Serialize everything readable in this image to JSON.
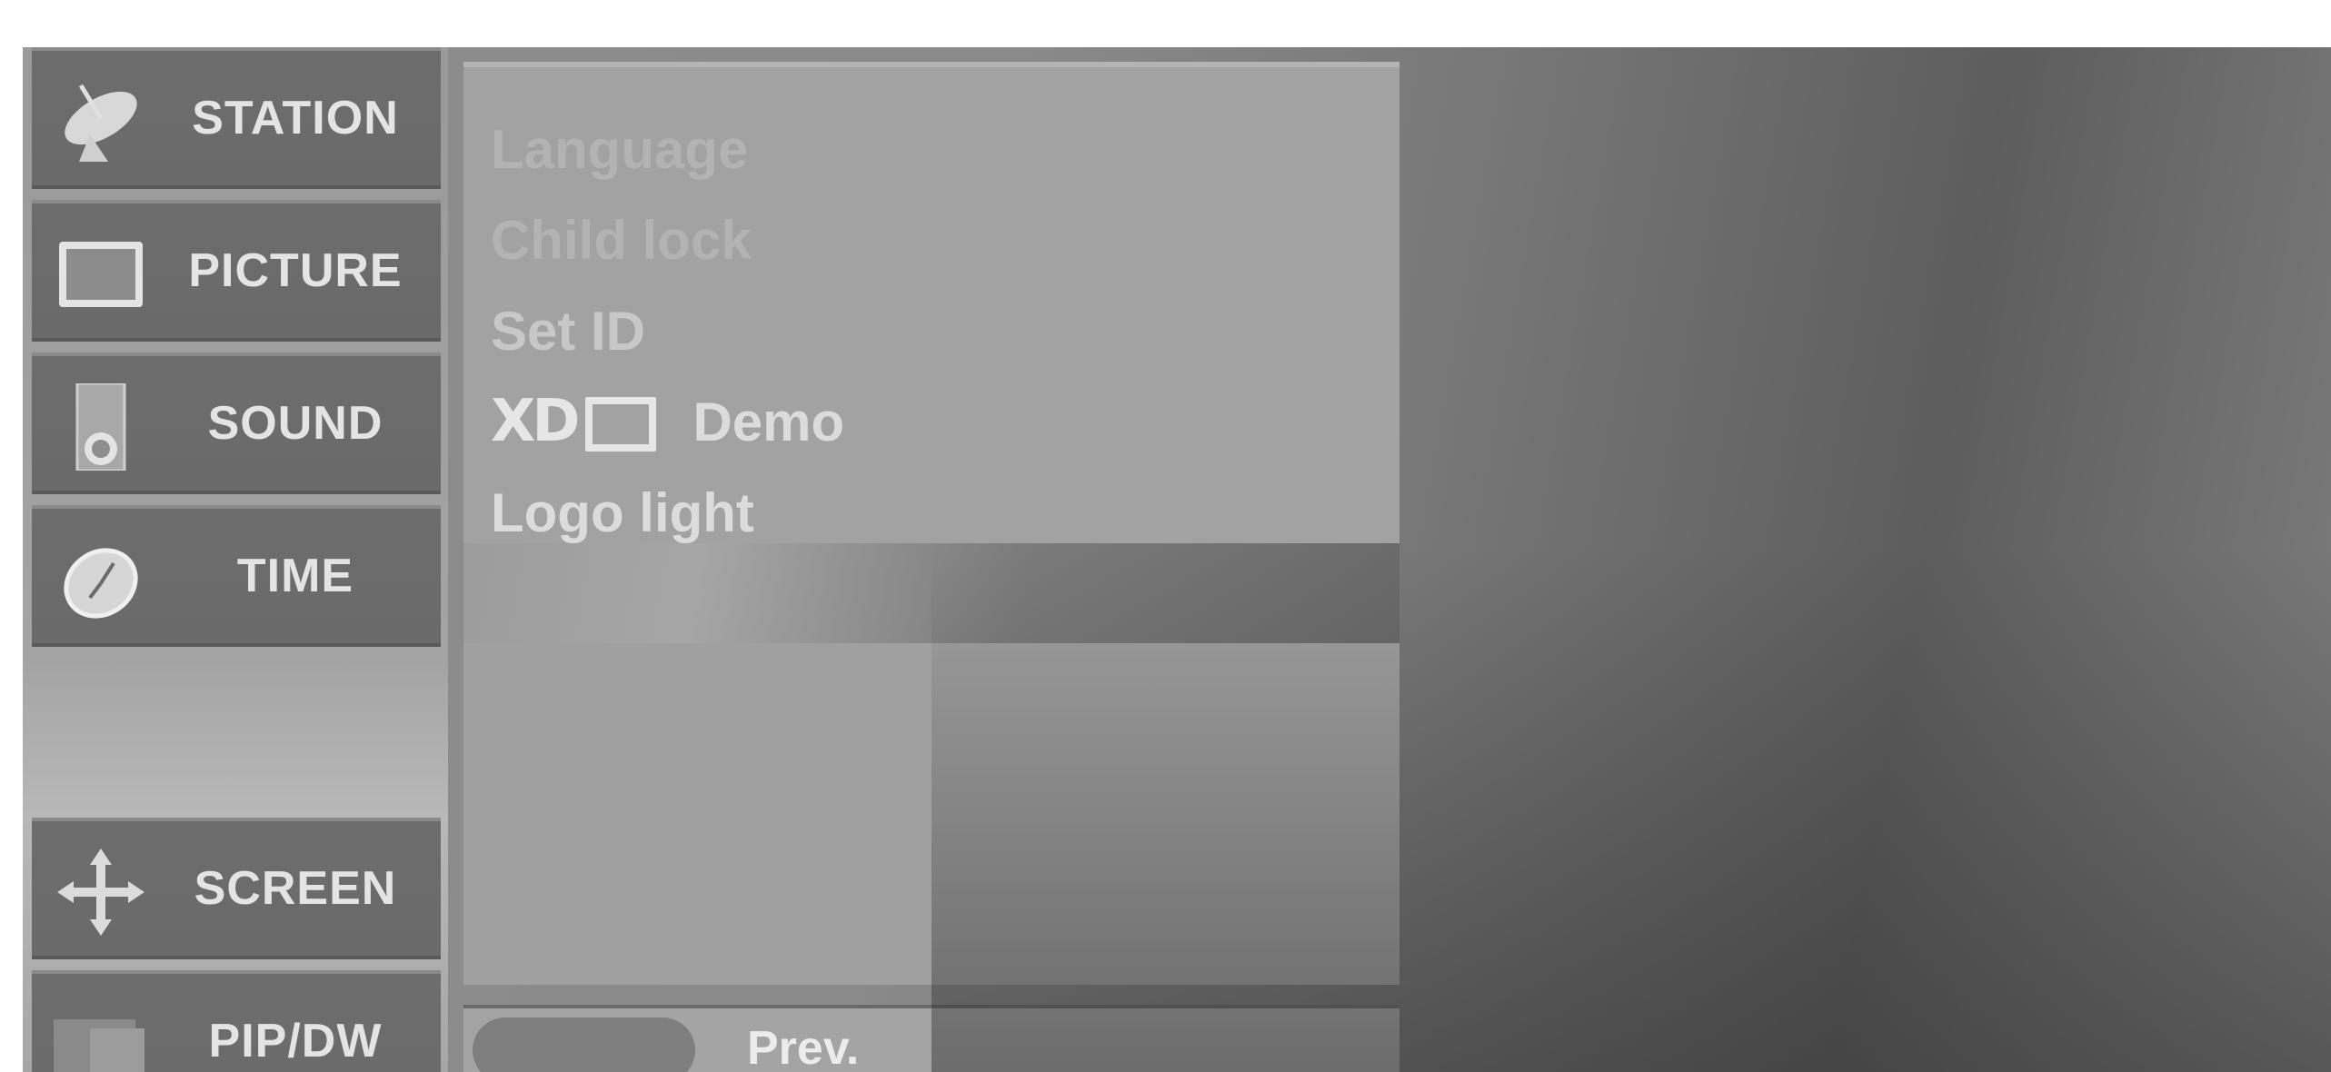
{
  "sidebar": {
    "items": [
      {
        "label": "STATION",
        "icon": "satellite-dish-icon"
      },
      {
        "label": "PICTURE",
        "icon": "picture-frame-icon"
      },
      {
        "label": "SOUND",
        "icon": "speaker-icon"
      },
      {
        "label": "TIME",
        "icon": "clock-icon"
      },
      {
        "label": "SCREEN",
        "icon": "move-arrows-icon"
      },
      {
        "label": "PIP/DW",
        "icon": "pip-window-icon"
      }
    ]
  },
  "submenu": {
    "items": [
      {
        "label": "Language",
        "state": "disabled"
      },
      {
        "label": "Child lock",
        "state": "disabled"
      },
      {
        "label": "Set ID",
        "state": "dim"
      },
      {
        "label": "Demo",
        "logo": "XD",
        "state": "normal"
      },
      {
        "label": "Logo light",
        "state": "normal"
      }
    ]
  },
  "footer": {
    "prev_label": "Prev."
  },
  "colors": {
    "menu_item_bg": "#6d6d6d",
    "panel_bg": "#a2a2a2",
    "text_light": "#e4e4e4"
  }
}
